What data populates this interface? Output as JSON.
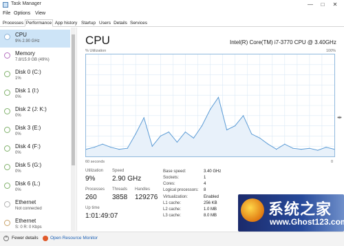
{
  "window": {
    "title": "Task Manager",
    "icon": "task-manager-icon",
    "minimize": "—",
    "maximize": "□",
    "close": "✕"
  },
  "menu": [
    "File",
    "Options",
    "View"
  ],
  "tabs": [
    "Processes",
    "Performance",
    "App history",
    "Startup",
    "Users",
    "Details",
    "Services"
  ],
  "sidebar": [
    {
      "name": "CPU",
      "sub": "9% 2.90 GHz"
    },
    {
      "name": "Memory",
      "sub": "7.8/15.9 GB (49%)"
    },
    {
      "name": "Disk 0 (C:)",
      "sub": "1%"
    },
    {
      "name": "Disk 1 (I:)",
      "sub": "0%"
    },
    {
      "name": "Disk 2 (J: K:)",
      "sub": "0%"
    },
    {
      "name": "Disk 3 (E:)",
      "sub": "0%"
    },
    {
      "name": "Disk 4 (F:)",
      "sub": "0%"
    },
    {
      "name": "Disk 5 (G:)",
      "sub": "0%"
    },
    {
      "name": "Disk 6 (L:)",
      "sub": "0%"
    },
    {
      "name": "Ethernet",
      "sub": "Not connected"
    },
    {
      "name": "Ethernet",
      "sub": "S: 0 R: 0 Kbps"
    }
  ],
  "main": {
    "title": "CPU",
    "cpu_name": "Intel(R) Core(TM) i7-3770 CPU @ 3.40GHz",
    "graph_label": "% Utilization",
    "graph_max": "100%",
    "axis_left": "60 seconds",
    "axis_right": "0",
    "resize_glyph": "⇹"
  },
  "stats": {
    "utilization_label": "Utilization",
    "utilization": "9%",
    "speed_label": "Speed",
    "speed": "2.90 GHz",
    "processes_label": "Processes",
    "processes": "260",
    "threads_label": "Threads",
    "threads": "3858",
    "handles_label": "Handles",
    "handles": "129276",
    "uptime_label": "Up time",
    "uptime": "1:01:49:07"
  },
  "specs": [
    {
      "label": "Base speed:",
      "value": "3.40 GHz"
    },
    {
      "label": "Sockets:",
      "value": "1"
    },
    {
      "label": "Cores:",
      "value": "4"
    },
    {
      "label": "Logical processors:",
      "value": "8"
    },
    {
      "label": "Virtualization:",
      "value": "Enabled"
    },
    {
      "label": "L1 cache:",
      "value": "256 KB"
    },
    {
      "label": "L2 cache:",
      "value": "1.0 MB"
    },
    {
      "label": "L3 cache:",
      "value": "8.0 MB"
    }
  ],
  "footer": {
    "fewer_details": "Fewer details",
    "open_resource_monitor": "Open Resource Monitor"
  },
  "watermark": {
    "text": "系统之家",
    "url": "www.Ghost123.com"
  },
  "colors": {
    "accent": "#1a5fb4",
    "graph_line": "#5b9bd5",
    "graph_fill": "#e8f1fa",
    "selected": "#cde4f7"
  },
  "chart_data": {
    "type": "area",
    "ylim": [
      0,
      100
    ],
    "xlim": [
      60,
      0
    ],
    "x": [
      60,
      58,
      56,
      54,
      52,
      50,
      48,
      46,
      44,
      42,
      40,
      38,
      36,
      34,
      32,
      30,
      28,
      26,
      24,
      22,
      20,
      18,
      16,
      14,
      12,
      10,
      8,
      6,
      4,
      2,
      0
    ],
    "values": [
      7,
      9,
      12,
      9,
      7,
      8,
      22,
      38,
      10,
      20,
      24,
      14,
      24,
      18,
      30,
      46,
      58,
      26,
      30,
      40,
      22,
      18,
      12,
      7,
      12,
      8,
      7,
      8,
      6,
      9,
      7
    ]
  }
}
